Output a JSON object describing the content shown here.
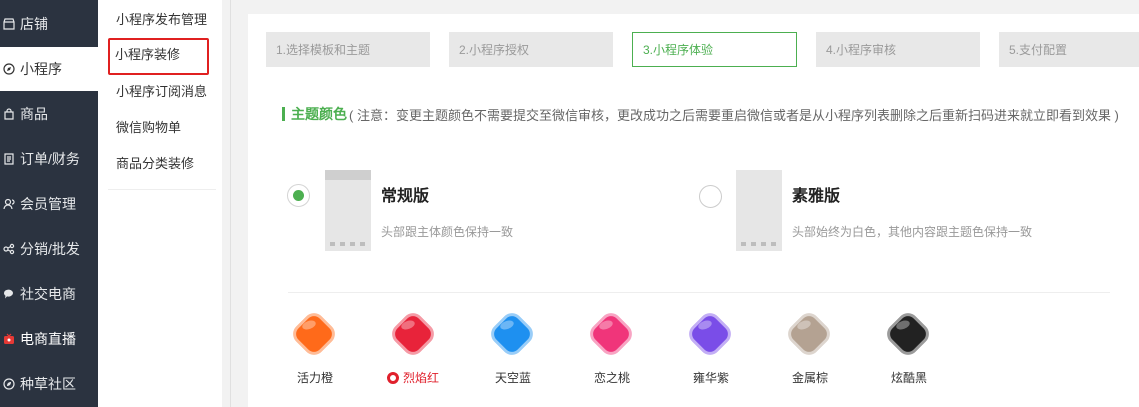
{
  "sidebar": {
    "items": [
      {
        "label": "店铺",
        "icon": "store-icon"
      },
      {
        "label": "小程序",
        "icon": "compass-icon",
        "active": true
      },
      {
        "label": "商品",
        "icon": "bag-icon"
      },
      {
        "label": "订单/财务",
        "icon": "receipt-icon"
      },
      {
        "label": "会员管理",
        "icon": "users-icon"
      },
      {
        "label": "分销/批发",
        "icon": "share-icon"
      },
      {
        "label": "社交电商",
        "icon": "chat-icon"
      },
      {
        "label": "电商直播",
        "icon": "live-tv-icon"
      },
      {
        "label": "种草社区",
        "icon": "community-icon"
      }
    ]
  },
  "submenu": {
    "items": [
      {
        "label": "小程序发布管理"
      },
      {
        "label": "小程序装修",
        "highlighted": true
      },
      {
        "label": "小程序订阅消息"
      },
      {
        "label": "微信购物单"
      },
      {
        "label": "商品分类装修"
      }
    ]
  },
  "steps": [
    {
      "label": "1.选择模板和主题"
    },
    {
      "label": "2.小程序授权"
    },
    {
      "label": "3.小程序体验",
      "current": true
    },
    {
      "label": "4.小程序审核"
    },
    {
      "label": "5.支付配置"
    }
  ],
  "theme": {
    "title": "主题颜色",
    "note": "( 注意：变更主题颜色不需要提交至微信审核，更改成功之后需要重启微信或者是从小程序列表删除之后重新扫码进来就立即看到效果 )"
  },
  "versions": [
    {
      "title": "常规版",
      "desc": "头部跟主体颜色保持一致",
      "checked": true
    },
    {
      "title": "素雅版",
      "desc": "头部始终为白色，其他内容跟主题色保持一致",
      "checked": false
    }
  ],
  "colors": [
    {
      "label": "活力橙",
      "color": "#ff6a1a"
    },
    {
      "label": "烈焰红",
      "color": "#e8233a",
      "selected": true
    },
    {
      "label": "天空蓝",
      "color": "#1e90f0"
    },
    {
      "label": "恋之桃",
      "color": "#f0357a"
    },
    {
      "label": "雍华紫",
      "color": "#7a4de8"
    },
    {
      "label": "金属棕",
      "color": "#b4a292"
    },
    {
      "label": "炫酷黑",
      "color": "#222222"
    }
  ],
  "accent": "#4caf50",
  "highlight_border": "#e02020"
}
